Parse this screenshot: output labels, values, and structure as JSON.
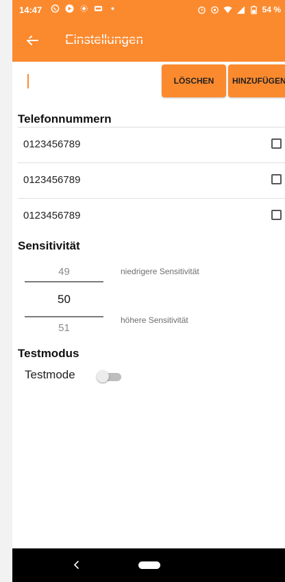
{
  "status_bar": {
    "time": "14:47",
    "left_icons": [
      "whatsapp-icon",
      "circle-app-icon",
      "sun-icon",
      "message-icon",
      "dot-icon"
    ],
    "right_icons": [
      "alarm-icon",
      "location-icon",
      "wifi-icon",
      "signal-icon",
      "battery-icon"
    ],
    "battery": "54 %"
  },
  "toolbar": {
    "title": "Einstellungen",
    "back_icon": "back-arrow-icon"
  },
  "input": {
    "value": "",
    "placeholder": ""
  },
  "buttons": {
    "delete": "LÖSCHEN",
    "add": "HINZUFÜGEN"
  },
  "phone_section": {
    "title": "Telefonnummern",
    "numbers": [
      {
        "number": "0123456789",
        "checked": false
      },
      {
        "number": "0123456789",
        "checked": false
      },
      {
        "number": "0123456789",
        "checked": false
      }
    ]
  },
  "sensitivity_section": {
    "title": "Sensitivität",
    "picker": {
      "previous": "49",
      "current": "50",
      "next": "51"
    },
    "label_lower": "niedrigere Sensitivität",
    "label_higher": "höhere Sensitivität"
  },
  "test_section": {
    "title": "Testmodus",
    "toggle_label": "Testmode",
    "toggle_on": false
  },
  "colors": {
    "accent": "#fb8a2f"
  }
}
